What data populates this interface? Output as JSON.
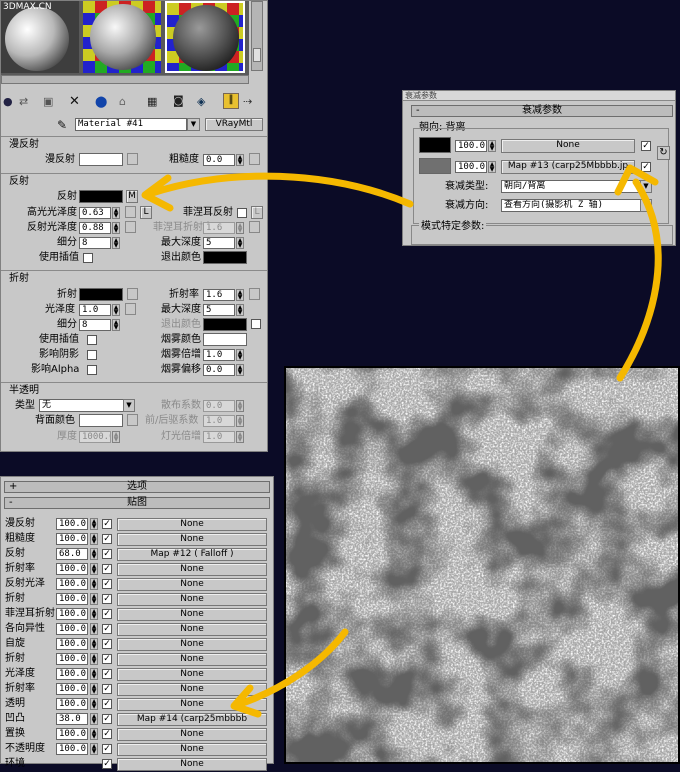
{
  "window_title": "3DMAX.CN",
  "material_editor": {
    "material_name": "Material #41",
    "material_type": "VRayMtl",
    "sections": {
      "diffuse": "漫反射",
      "reflection": "反射",
      "refraction": "折射",
      "translucency": "半透明"
    },
    "diffuse": {
      "label": "漫反射",
      "roughness_label": "粗糙度",
      "roughness": "0.0"
    },
    "reflection": {
      "label": "反射",
      "map_button": "M",
      "hilight_gloss_label": "高光光泽度",
      "hilight_gloss": "0.63",
      "lock": "L",
      "fresnel_label": "菲涅耳反射",
      "refl_gloss_label": "反射光泽度",
      "refl_gloss": "0.88",
      "fresnel_ior_label": "菲涅耳折射率",
      "fresnel_ior": "1.6",
      "subdivs_label": "细分",
      "subdivs": "8",
      "max_depth_label": "最大深度",
      "max_depth": "5",
      "interp_label": "使用插值",
      "exit_color_label": "退出颜色"
    },
    "refraction": {
      "label": "折射",
      "ior_label": "折射率",
      "ior": "1.6",
      "gloss_label": "光泽度",
      "gloss": "1.0",
      "max_depth_label": "最大深度",
      "max_depth": "5",
      "subdivs_label": "细分",
      "subdivs": "8",
      "exit_color_label": "退出颜色",
      "interp_label": "使用插值",
      "fog_color_label": "烟雾颜色",
      "shadows_label": "影响阴影",
      "fog_mult_label": "烟雾倍增",
      "fog_mult": "1.0",
      "alpha_label": "影响Alpha",
      "fog_bias_label": "烟雾偏移",
      "fog_bias": "0.0"
    },
    "translucency": {
      "type_label": "类型",
      "type_value": "无",
      "scatter_label": "散布系数",
      "scatter": "0.0",
      "back_color_label": "背面颜色",
      "fwd_back_label": "前/后驱系数",
      "fwd_back": "1.0",
      "thickness_label": "厚度",
      "thickness": "1000.0",
      "light_mult_label": "灯光倍增",
      "light_mult": "1.0"
    }
  },
  "maps_panel": {
    "options_rollout": "选项",
    "maps_rollout": "贴图",
    "rows": [
      {
        "label": "漫反射",
        "amount": "100.0",
        "map": "None"
      },
      {
        "label": "粗糙度",
        "amount": "100.0",
        "map": "None"
      },
      {
        "label": "反射",
        "amount": "68.0",
        "map": "Map #12  ( Falloff )"
      },
      {
        "label": "折射率",
        "amount": "100.0",
        "map": "None"
      },
      {
        "label": "反射光泽",
        "amount": "100.0",
        "map": "None"
      },
      {
        "label": "折射",
        "amount": "100.0",
        "map": "None"
      },
      {
        "label": "菲涅耳折射",
        "amount": "100.0",
        "map": "None"
      },
      {
        "label": "各向异性",
        "amount": "100.0",
        "map": "None"
      },
      {
        "label": "自旋",
        "amount": "100.0",
        "map": "None"
      },
      {
        "label": "折射",
        "amount": "100.0",
        "map": "None"
      },
      {
        "label": "光泽度",
        "amount": "100.0",
        "map": "None"
      },
      {
        "label": "折射率",
        "amount": "100.0",
        "map": "None"
      },
      {
        "label": "透明",
        "amount": "100.0",
        "map": "None"
      },
      {
        "label": "凹凸",
        "amount": "38.0",
        "map": "Map #14 (carp25mbbbb"
      },
      {
        "label": "置换",
        "amount": "100.0",
        "map": "None"
      },
      {
        "label": "不透明度",
        "amount": "100.0",
        "map": "None"
      },
      {
        "label": "环境",
        "amount": "",
        "map": "None"
      }
    ]
  },
  "falloff_panel": {
    "title_fragment": "衰减参数",
    "rollout": "衰减参数",
    "group": "朝向: 背离",
    "row1": {
      "amount": "100.0",
      "map": "None"
    },
    "row2": {
      "amount": "100.0",
      "map": "Map #13 (carp25Mbbbb.jp"
    },
    "falloff_type_label": "衰减类型:",
    "falloff_type": "朝向/背离",
    "falloff_dir_label": "衰减方向:",
    "falloff_dir": "查看方向(摄影机 Z 轴)",
    "mode_rollout": "模式特定参数:"
  },
  "colors": {
    "accent_arrow": "#f5b800",
    "panel_bg": "#c8c8c8",
    "background": "#0b0b26"
  }
}
